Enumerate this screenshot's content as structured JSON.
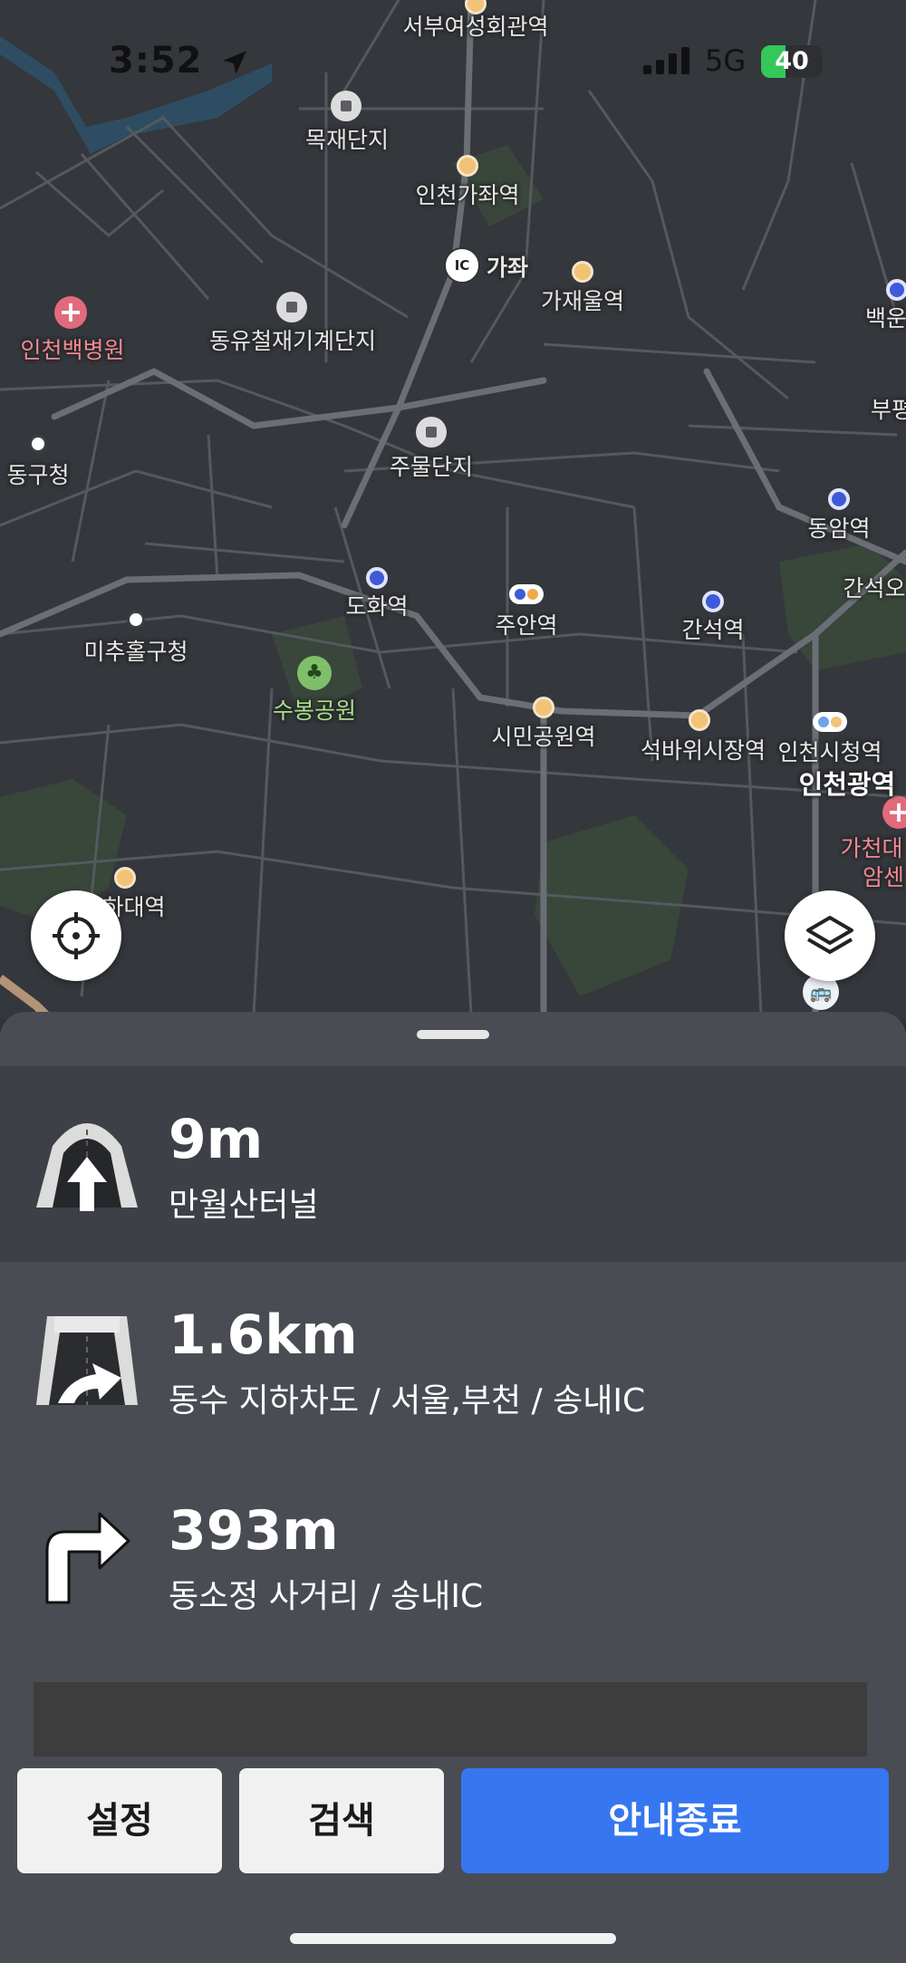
{
  "status_bar": {
    "time": "3:52",
    "network": "5G",
    "battery": "40",
    "battery_level": 0.4
  },
  "map": {
    "labels": [
      {
        "text": "서부여성회관역",
        "kind": "white"
      },
      {
        "text": "목재단지",
        "kind": "white"
      },
      {
        "text": "인천가좌역",
        "kind": "white"
      },
      {
        "text": "가좌",
        "kind": "white"
      },
      {
        "text": "가재울역",
        "kind": "white"
      },
      {
        "text": "인천백병원",
        "kind": "pink"
      },
      {
        "text": "동유철재기계단지",
        "kind": "white"
      },
      {
        "text": "백운",
        "kind": "white"
      },
      {
        "text": "부평",
        "kind": "white"
      },
      {
        "text": "동구청",
        "kind": "white"
      },
      {
        "text": "주물단지",
        "kind": "white"
      },
      {
        "text": "동암역",
        "kind": "white"
      },
      {
        "text": "간석오",
        "kind": "white"
      },
      {
        "text": "도화역",
        "kind": "white"
      },
      {
        "text": "주안역",
        "kind": "white"
      },
      {
        "text": "간석역",
        "kind": "white"
      },
      {
        "text": "미추홀구청",
        "kind": "white"
      },
      {
        "text": "수봉공원",
        "kind": "green"
      },
      {
        "text": "시민공원역",
        "kind": "white"
      },
      {
        "text": "석바위시장역",
        "kind": "white"
      },
      {
        "text": "인천시청역",
        "kind": "white"
      },
      {
        "text": "인천광역",
        "kind": "bold"
      },
      {
        "text": "가천대",
        "kind": "pink"
      },
      {
        "text": "암센",
        "kind": "pink"
      },
      {
        "text": "하대역",
        "kind": "white"
      }
    ],
    "ic_badge": "IC",
    "bus_icon": "bus-icon",
    "locate_icon": "crosshair-icon",
    "layers_icon": "layers-icon"
  },
  "guidance": {
    "steps": [
      {
        "distance": "9m",
        "description": "만월산터널",
        "icon": "tunnel-straight-icon"
      },
      {
        "distance": "1.6km",
        "description": "동수 지하차도 / 서울,부천 / 송내IC",
        "icon": "underpass-right-icon"
      },
      {
        "distance": "393m",
        "description": "동소정 사거리 / 송내IC",
        "icon": "turn-right-icon"
      }
    ]
  },
  "buttons": {
    "settings": "설정",
    "search": "검색",
    "end_guidance": "안내종료"
  },
  "colors": {
    "primary_button": "#3676f0",
    "sheet_bg": "#494c53",
    "current_step_bg": "#3d4046",
    "map_bg": "#34373c"
  }
}
